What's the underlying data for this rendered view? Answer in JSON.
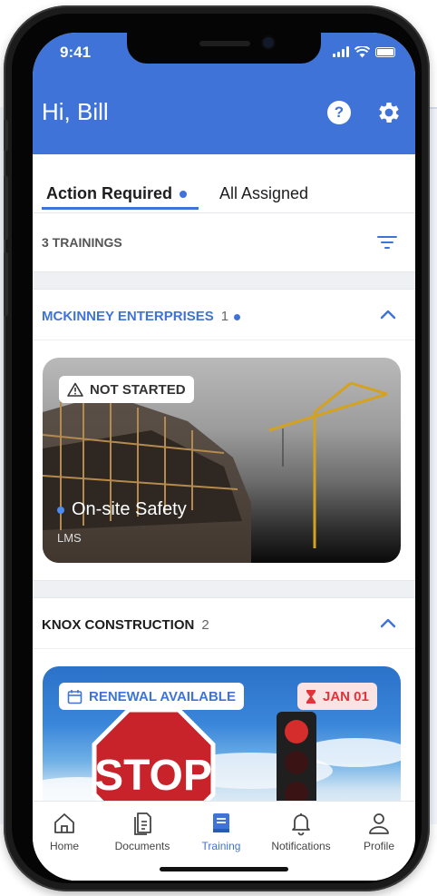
{
  "status_bar": {
    "time": "9:41"
  },
  "header": {
    "greeting": "Hi, Bill",
    "help_symbol": "?"
  },
  "tabs": [
    {
      "label": "Action Required",
      "active": true,
      "has_dot": true
    },
    {
      "label": "All Assigned",
      "active": false
    }
  ],
  "list_header": {
    "count_label": "3 TRAININGS"
  },
  "groups": [
    {
      "name": "MCKINNEY ENTERPRISES",
      "count": "1",
      "has_dot": true,
      "card": {
        "status": "NOT STARTED",
        "title": "On-site Safety",
        "source": "LMS"
      }
    },
    {
      "name": "KNOX CONSTRUCTION",
      "count": "2",
      "card": {
        "status": "RENEWAL AVAILABLE",
        "due": "JAN 01",
        "sign_text": "STOP"
      }
    }
  ],
  "bottom_nav": [
    {
      "label": "Home",
      "icon": "home-icon"
    },
    {
      "label": "Documents",
      "icon": "documents-icon"
    },
    {
      "label": "Training",
      "icon": "training-icon",
      "active": true
    },
    {
      "label": "Notifications",
      "icon": "bell-icon"
    },
    {
      "label": "Profile",
      "icon": "profile-icon"
    }
  ],
  "colors": {
    "primary": "#3f73d8",
    "alert": "#e2343a",
    "alert_bg": "#fbe2e3"
  }
}
